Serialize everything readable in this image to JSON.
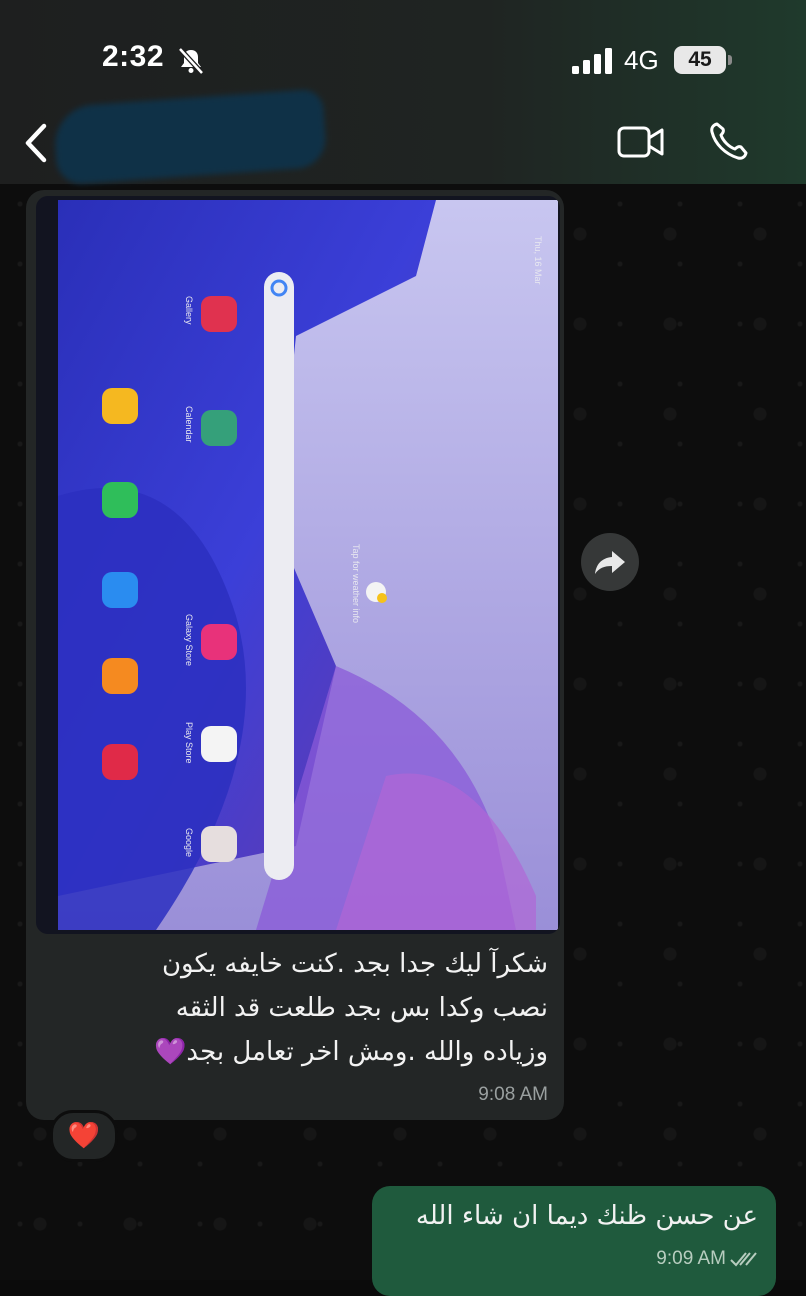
{
  "status_bar": {
    "time": "2:32",
    "network": "4G",
    "battery": "45"
  },
  "header": {
    "contact_name": ""
  },
  "messages": {
    "incoming": {
      "lines": [
        "شكرآ ليك جدا بجد .كنت خايفه يكون",
        "نصب وكدا بس بجد طلعت قد الثقه",
        "وزياده والله .ومش اخر تعامل بجد💜"
      ],
      "time": "9:08 AM",
      "reaction": "❤️"
    },
    "outgoing": {
      "text": "عن حسن ظنك ديما ان شاء الله",
      "time": "9:09 AM"
    }
  },
  "photo": {
    "apps": [
      {
        "label": "Gallery"
      },
      {
        "label": "Calendar"
      },
      {
        "label": "Galaxy Store"
      },
      {
        "label": "Play Store"
      },
      {
        "label": "Google"
      }
    ],
    "weather_hint": "Tap for weather info",
    "date": "Thu, 16 Mar"
  },
  "colors": {
    "header_bg": "#1e1f1f",
    "incoming_bubble": "#232626",
    "outgoing_bubble": "#1f5a3d",
    "heart": "#e8202e"
  }
}
